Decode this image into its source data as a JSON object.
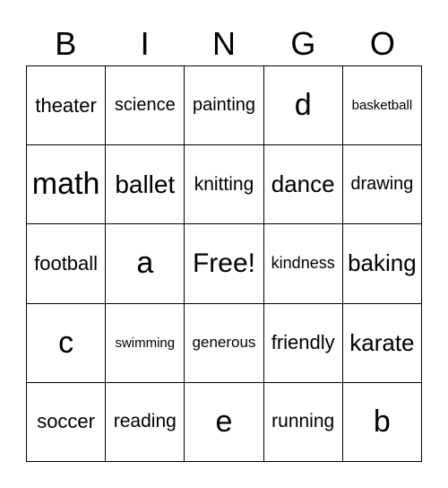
{
  "header": [
    "B",
    "I",
    "N",
    "G",
    "O"
  ],
  "cells": [
    "theater",
    "science",
    "painting",
    "d",
    "basketball",
    "math",
    "ballet",
    "knitting",
    "dance",
    "drawing",
    "football",
    "a",
    "Free!",
    "kindness",
    "baking",
    "c",
    "swimming",
    "generous",
    "friendly",
    "karate",
    "soccer",
    "reading",
    "e",
    "running",
    "b"
  ]
}
